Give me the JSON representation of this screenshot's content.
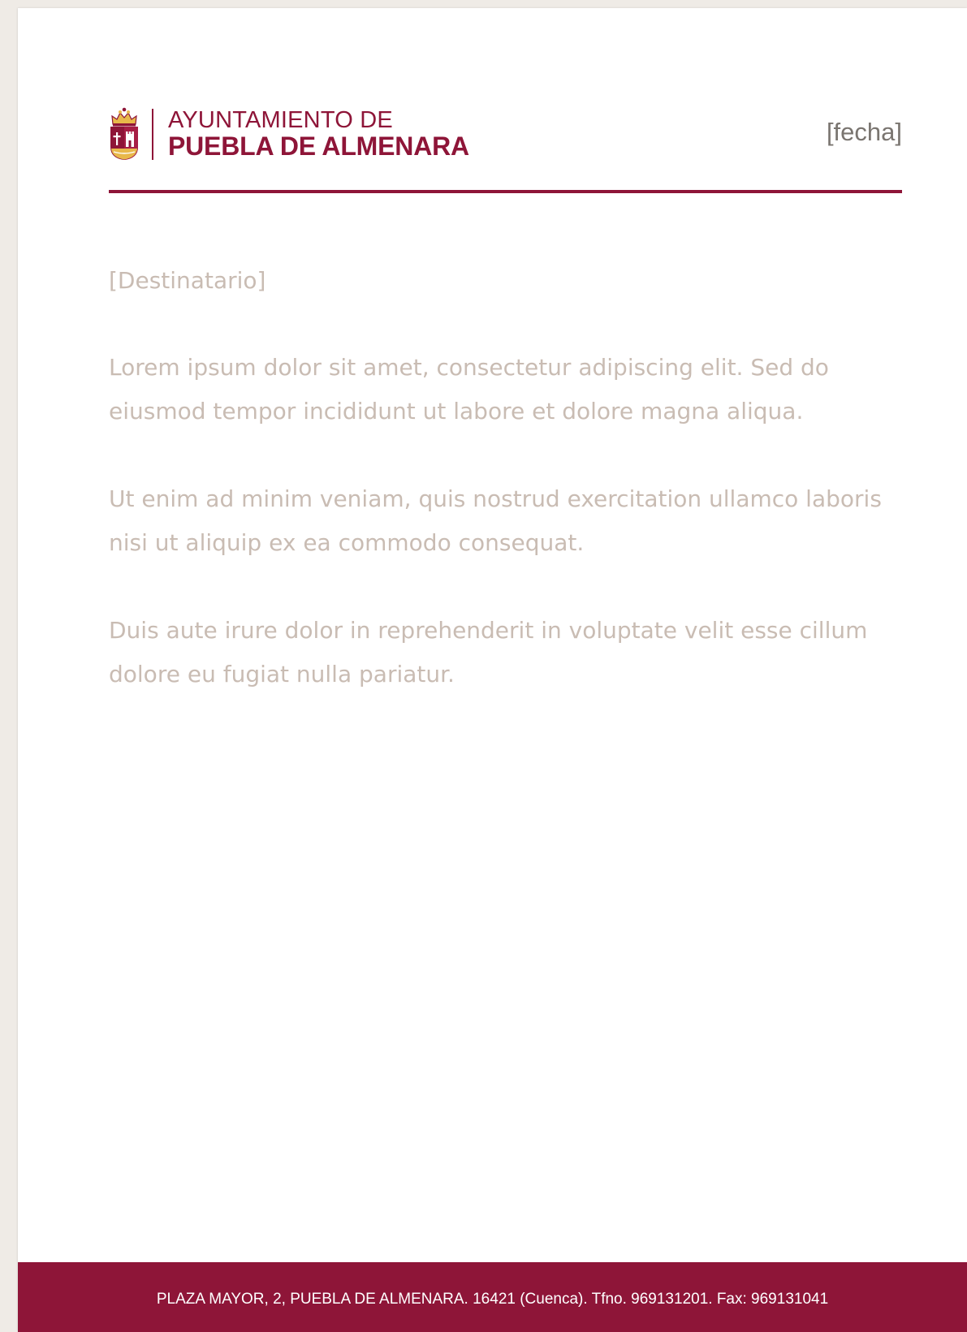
{
  "header": {
    "logo": {
      "line1": "AYUNTAMIENTO DE",
      "line2": "PUEBLA DE ALMENARA",
      "crest_icon": "coat-of-arms-icon"
    },
    "date_placeholder": "[fecha]"
  },
  "body": {
    "recipient": "[Destinatario]",
    "paragraphs": [
      "Lorem ipsum dolor sit amet, consectetur adipiscing elit. Sed do eiusmod tempor incididunt ut labore et dolore magna aliqua.",
      "Ut enim ad minim veniam, quis nostrud exercitation ullamco laboris nisi ut aliquip ex ea commodo consequat.",
      "Duis aute irure dolor in reprehenderit in voluptate velit esse cillum dolore eu fugiat nulla pariatur."
    ]
  },
  "footer": {
    "address": "PLAZA MAYOR, 2, PUEBLA DE ALMENARA. 16421 (Cuenca). Tfno. 969131201. Fax: 969131041"
  },
  "colors": {
    "brand": "#8e1538",
    "placeholder_text": "#c9bcb3",
    "date_text": "#7a7570",
    "background": "#efebe6",
    "crest_gold": "#e8b84a"
  }
}
